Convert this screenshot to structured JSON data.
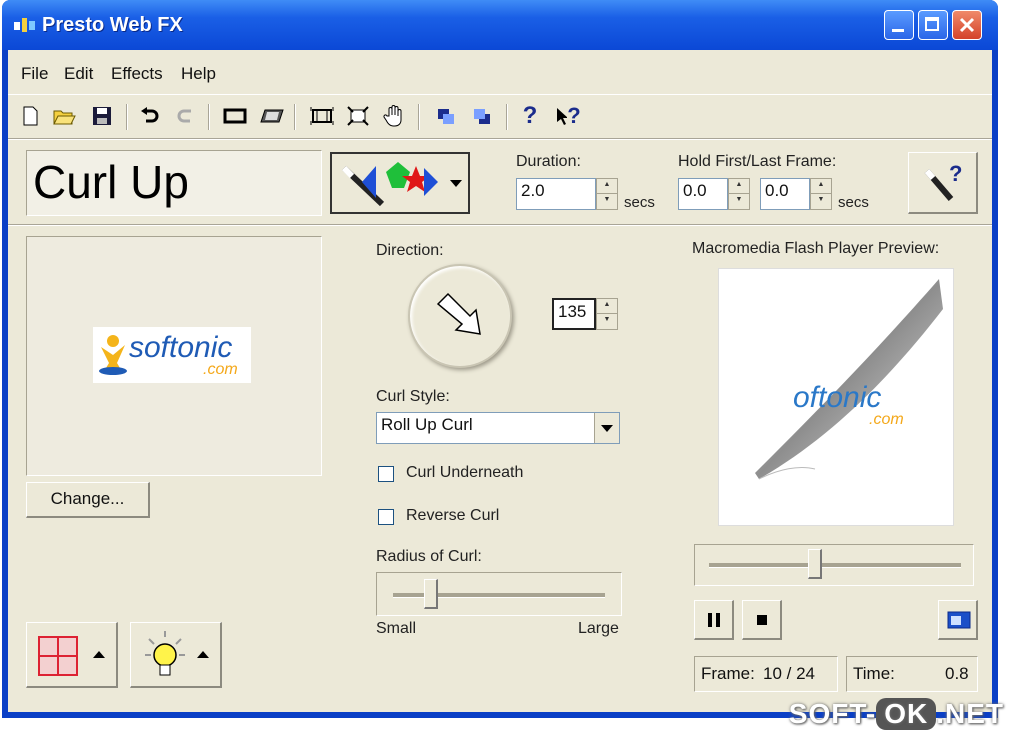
{
  "window": {
    "title": "Presto Web FX"
  },
  "menu": {
    "items": [
      "File",
      "Edit",
      "Effects",
      "Help"
    ]
  },
  "toolbar": {
    "icons": [
      "new-icon",
      "open-icon",
      "save-icon",
      "undo-icon",
      "redo-icon",
      "frame-icon",
      "filmstrip-icon",
      "fit-icon",
      "fullscreen-icon",
      "hand-icon",
      "back-icon",
      "forward-icon",
      "help-icon",
      "context-help-icon"
    ]
  },
  "effect": {
    "name": "Curl Up"
  },
  "duration": {
    "label": "Duration:",
    "value": "2.0",
    "unit": "secs"
  },
  "hold": {
    "label": "Hold First/Last Frame:",
    "first": "0.0",
    "last": "0.0",
    "unit": "secs"
  },
  "image": {
    "logo_main": "softonic",
    "logo_sub": ".com",
    "change_label": "Change..."
  },
  "direction": {
    "label": "Direction:",
    "value": "135"
  },
  "curl_style": {
    "label": "Curl Style:",
    "selected": "Roll Up Curl"
  },
  "options": {
    "curl_underneath": "Curl Underneath",
    "reverse_curl": "Reverse Curl",
    "curl_underneath_checked": false,
    "reverse_curl_checked": false
  },
  "radius": {
    "label": "Radius of Curl:",
    "small": "Small",
    "large": "Large",
    "value": 0.18
  },
  "preview": {
    "title": "Macromedia Flash Player Preview:",
    "logo_main": "oftonic",
    "logo_sub": ".com",
    "frame_label": "Frame:",
    "frame_value": "10 / 24",
    "time_label": "Time:",
    "time_value": "0.8",
    "progress": 0.42
  },
  "watermark": {
    "left": "SOFT-",
    "mid": "OK",
    "right": ".NET"
  }
}
